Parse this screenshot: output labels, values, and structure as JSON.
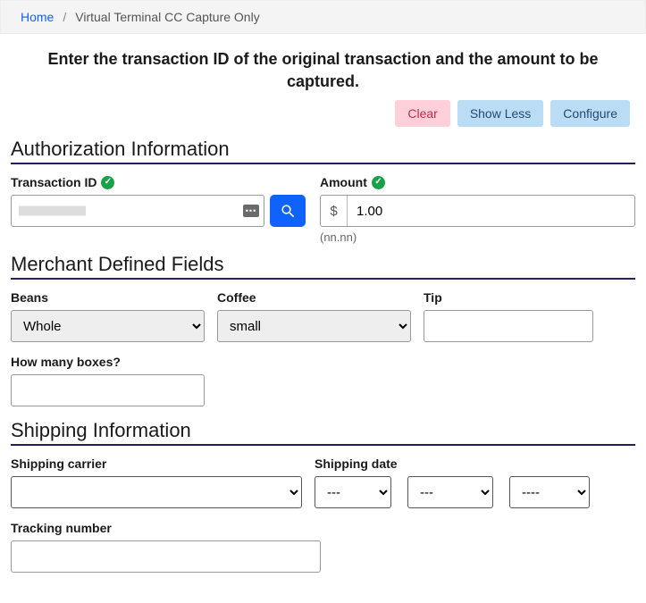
{
  "breadcrumb": {
    "home": "Home",
    "current": "Virtual Terminal CC Capture Only"
  },
  "instruction": "Enter the transaction ID of the original transaction and the amount to be captured.",
  "buttons": {
    "clear": "Clear",
    "show_less": "Show Less",
    "configure": "Configure"
  },
  "sections": {
    "auth": "Authorization Information",
    "merchant": "Merchant Defined Fields",
    "shipping": "Shipping Information"
  },
  "auth": {
    "transaction_id_label": "Transaction ID",
    "amount_label": "Amount",
    "amount_value": "1.00",
    "amount_hint": "(nn.nn)",
    "currency_symbol": "$"
  },
  "merchant": {
    "beans_label": "Beans",
    "beans_value": "Whole",
    "coffee_label": "Coffee",
    "coffee_value": "small",
    "tip_label": "Tip",
    "boxes_label": "How many boxes?"
  },
  "shipping": {
    "carrier_label": "Shipping carrier",
    "date_label": "Shipping date",
    "date_mm": "---",
    "date_dd": "---",
    "date_yyyy": "----",
    "tracking_label": "Tracking number"
  }
}
